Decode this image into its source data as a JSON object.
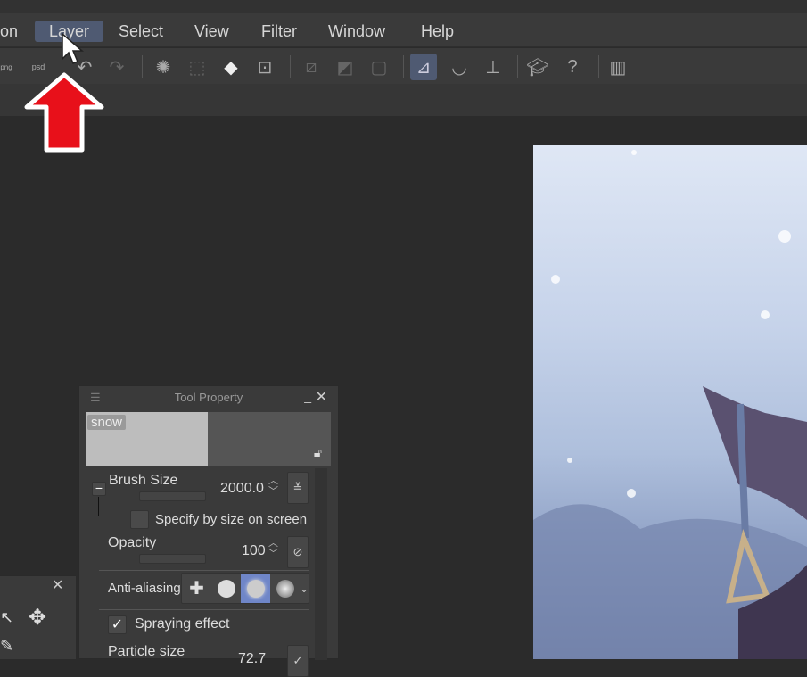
{
  "menu": {
    "items": [
      {
        "label": "on"
      },
      {
        "label": "Layer"
      },
      {
        "label": "Select"
      },
      {
        "label": "View"
      },
      {
        "label": "Filter"
      },
      {
        "label": "Window"
      },
      {
        "label": "Help"
      }
    ],
    "active": "Layer"
  },
  "toolbar": {
    "png_label": "png",
    "psd_label": "psd"
  },
  "tool_property": {
    "title": "Tool Property",
    "preset_name": "snow",
    "brush_size": {
      "label": "Brush Size",
      "value": "2000.0"
    },
    "specify_by_size_on_screen": {
      "label": "Specify by size on screen",
      "checked": false
    },
    "opacity": {
      "label": "Opacity",
      "value": "100"
    },
    "anti_aliasing": {
      "label": "Anti-aliasing",
      "selected_index": 2
    },
    "spraying_effect": {
      "label": "Spraying effect",
      "checked": true
    },
    "particle_size": {
      "label": "Particle size",
      "value": "72.7"
    }
  },
  "colors": {
    "accent": "#4f5a72",
    "arrow": "#e8101a"
  }
}
